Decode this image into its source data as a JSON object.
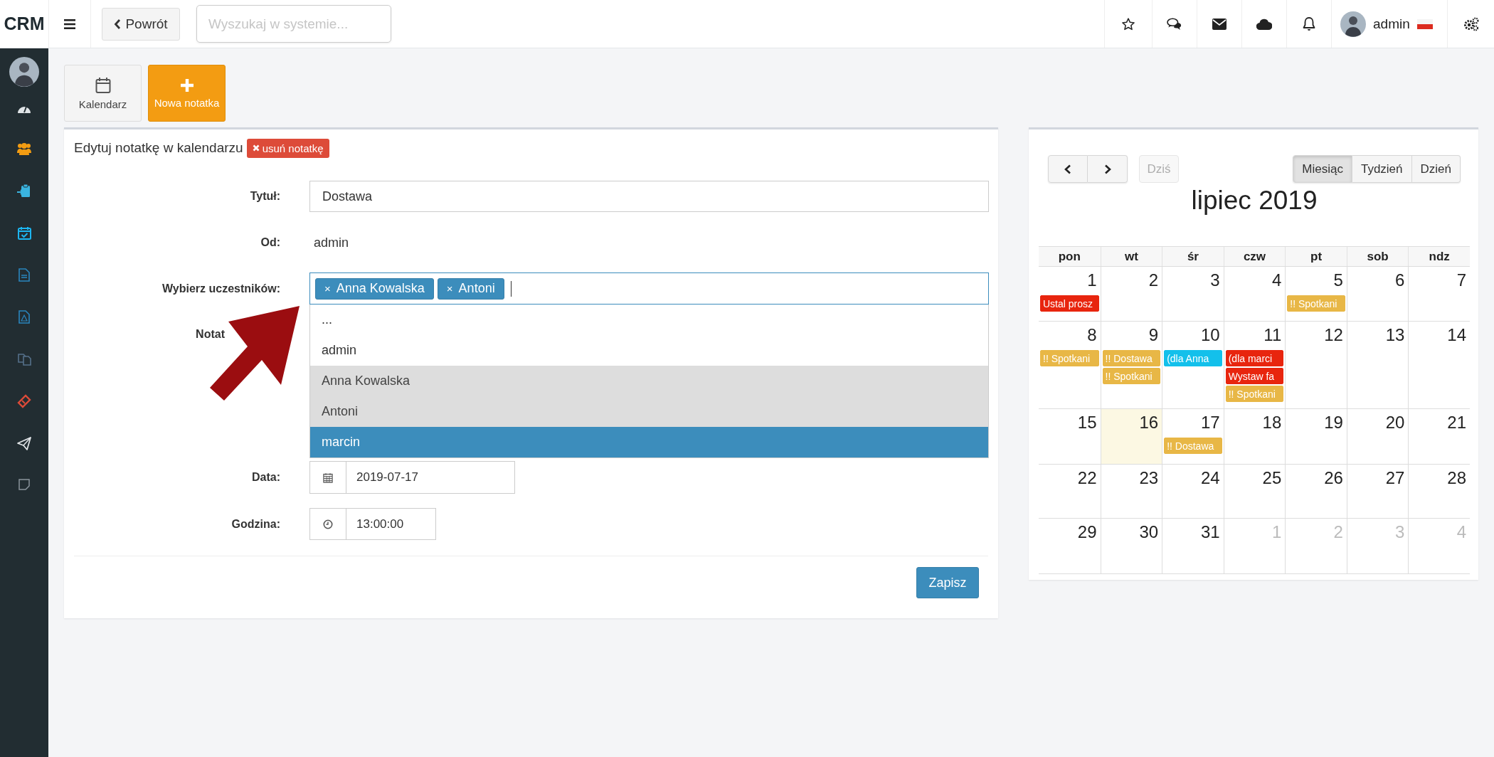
{
  "app": {
    "logo": "CRM"
  },
  "topbar": {
    "back_button": "Powrót",
    "search": {
      "placeholder": "Wyszukaj w systemie..."
    },
    "user": {
      "name": "admin"
    }
  },
  "toolbar": {
    "buttons": [
      {
        "label": "Kalendarz",
        "kind": "calendar"
      },
      {
        "label": "Nowa notatka",
        "kind": "add"
      }
    ]
  },
  "form": {
    "title": "Edytuj notatkę w kalendarzu",
    "delete_label": "usuń notatkę",
    "submit": "Zapisz",
    "fields": [
      {
        "label": "Tytuł:",
        "kind": "text",
        "value": "Dostawa"
      },
      {
        "label": "Od:",
        "kind": "static",
        "value": "admin"
      },
      {
        "label": "Wybierz uczestników:",
        "kind": "tags",
        "tags": [
          {
            "remove": "×",
            "label": "Anna Kowalska"
          },
          {
            "remove": "×",
            "label": "Antoni"
          }
        ],
        "options": [
          {
            "label": "...",
            "chosen": false,
            "selected": false
          },
          {
            "label": "admin",
            "chosen": false,
            "selected": false
          },
          {
            "label": "Anna Kowalska",
            "chosen": true,
            "selected": false
          },
          {
            "label": "Antoni",
            "chosen": true,
            "selected": false
          },
          {
            "label": "marcin",
            "chosen": false,
            "selected": true
          }
        ]
      },
      {
        "label": "Notat",
        "kind": "covered"
      },
      {
        "label": "Data:",
        "kind": "date",
        "value": "2019-07-17"
      },
      {
        "label": "Godzina:",
        "kind": "time",
        "value": "13:00:00"
      }
    ]
  },
  "calendar": {
    "title": "lipiec 2019",
    "today_button": {
      "label": "Dziś",
      "disabled": true
    },
    "views": [
      {
        "label": "Miesiąc",
        "selected": true
      },
      {
        "label": "Tydzień",
        "selected": false
      },
      {
        "label": "Dzień",
        "selected": false
      }
    ],
    "weekdays": [
      "pon",
      "wt",
      "śr",
      "czw",
      "pt",
      "sob",
      "ndz"
    ],
    "weeks": [
      [
        {
          "day": "1",
          "other_month": false,
          "today": false,
          "events": [
            {
              "text": "Ustal prosz",
              "color": "#e8250e"
            }
          ]
        },
        {
          "day": "2",
          "other_month": false,
          "today": false
        },
        {
          "day": "3",
          "other_month": false,
          "today": false
        },
        {
          "day": "4",
          "other_month": false,
          "today": false
        },
        {
          "day": "5",
          "other_month": false,
          "today": false,
          "events": [
            {
              "text": "!! Spotkani",
              "color": "#e8b746"
            }
          ]
        },
        {
          "day": "6",
          "other_month": false,
          "today": false
        },
        {
          "day": "7",
          "other_month": false,
          "today": false
        }
      ],
      [
        {
          "day": "8",
          "other_month": false,
          "today": false,
          "events": [
            {
              "text": "!! Spotkani",
              "color": "#e8b746"
            }
          ]
        },
        {
          "day": "9",
          "other_month": false,
          "today": false,
          "events": [
            {
              "text": "!! Dostawa",
              "color": "#e8b746"
            },
            {
              "text": "!! Spotkani",
              "color": "#e8b746"
            }
          ]
        },
        {
          "day": "10",
          "other_month": false,
          "today": false,
          "events": [
            {
              "text": "(dla Anna",
              "color": "#13c0eb"
            }
          ]
        },
        {
          "day": "11",
          "other_month": false,
          "today": false,
          "events": [
            {
              "text": "(dla marci",
              "color": "#e8250e"
            },
            {
              "text": "Wystaw fa",
              "color": "#e8250e"
            },
            {
              "text": "!! Spotkani",
              "color": "#e8b746"
            }
          ]
        },
        {
          "day": "12",
          "other_month": false,
          "today": false
        },
        {
          "day": "13",
          "other_month": false,
          "today": false
        },
        {
          "day": "14",
          "other_month": false,
          "today": false
        }
      ],
      [
        {
          "day": "15",
          "other_month": false,
          "today": false
        },
        {
          "day": "16",
          "other_month": false,
          "today": true
        },
        {
          "day": "17",
          "other_month": false,
          "today": false,
          "events": [
            {
              "text": "!! Dostawa",
              "color": "#e8b746"
            }
          ]
        },
        {
          "day": "18",
          "other_month": false,
          "today": false
        },
        {
          "day": "19",
          "other_month": false,
          "today": false
        },
        {
          "day": "20",
          "other_month": false,
          "today": false
        },
        {
          "day": "21",
          "other_month": false,
          "today": false
        }
      ],
      [
        {
          "day": "22",
          "other_month": false,
          "today": false
        },
        {
          "day": "23",
          "other_month": false,
          "today": false
        },
        {
          "day": "24",
          "other_month": false,
          "today": false
        },
        {
          "day": "25",
          "other_month": false,
          "today": false
        },
        {
          "day": "26",
          "other_month": false,
          "today": false
        },
        {
          "day": "27",
          "other_month": false,
          "today": false
        },
        {
          "day": "28",
          "other_month": false,
          "today": false
        }
      ],
      [
        {
          "day": "29",
          "other_month": false,
          "today": false
        },
        {
          "day": "30",
          "other_month": false,
          "today": false
        },
        {
          "day": "31",
          "other_month": false,
          "today": false
        },
        {
          "day": "1",
          "other_month": true,
          "today": false
        },
        {
          "day": "2",
          "other_month": true,
          "today": false
        },
        {
          "day": "3",
          "other_month": true,
          "today": false
        },
        {
          "day": "4",
          "other_month": true,
          "today": false
        }
      ]
    ]
  }
}
